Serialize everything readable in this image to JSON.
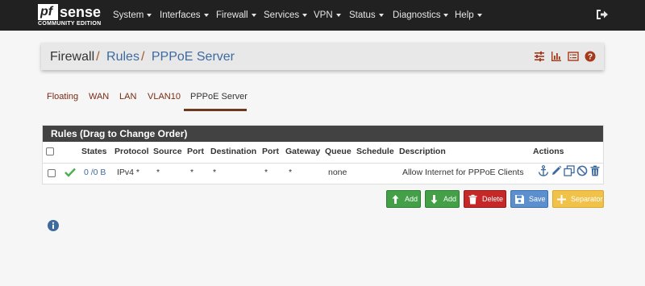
{
  "brand": {
    "logo_pf": "pf",
    "logo_sense": "sense",
    "edition": "COMMUNITY EDITION"
  },
  "nav": {
    "items": [
      {
        "label": "System"
      },
      {
        "label": "Interfaces"
      },
      {
        "label": "Firewall"
      },
      {
        "label": "Services"
      },
      {
        "label": "VPN"
      },
      {
        "label": "Status"
      },
      {
        "label": "Diagnostics"
      },
      {
        "label": "Help"
      }
    ],
    "logout_icon": "sign-out-icon"
  },
  "breadcrumb": {
    "firewall": "Firewall",
    "rules": "Rules",
    "current": "PPPoE Server",
    "separator": "/"
  },
  "header_icons": [
    "sliders-icon",
    "bar-chart-icon",
    "list-icon",
    "help-icon"
  ],
  "tabs": [
    {
      "label": "Floating",
      "active": false
    },
    {
      "label": "WAN",
      "active": false
    },
    {
      "label": "LAN",
      "active": false
    },
    {
      "label": "VLAN10",
      "active": false
    },
    {
      "label": "PPPoE Server",
      "active": true
    }
  ],
  "rules": {
    "title": "Rules (Drag to Change Order)",
    "columns": {
      "states": "States",
      "protocol": "Protocol",
      "source": "Source",
      "port": "Port",
      "destination": "Destination",
      "dest_port": "Port",
      "gateway": "Gateway",
      "queue": "Queue",
      "schedule": "Schedule",
      "description": "Description",
      "actions": "Actions"
    },
    "rows": [
      {
        "enabled_icon": "check-icon",
        "states": "0 /0 B",
        "protocol": "IPv4 *",
        "source": "*",
        "port": "*",
        "destination": "*",
        "dest_port": "*",
        "gateway": "*",
        "queue": "none",
        "schedule": "",
        "description": "Allow Internet for PPPoE Clients",
        "actions": [
          "anchor-icon",
          "pencil-icon",
          "copy-icon",
          "disable-icon",
          "trash-icon"
        ]
      }
    ]
  },
  "buttons": {
    "add_top": "Add",
    "add_bottom": "Add",
    "delete": "Delete",
    "save": "Save",
    "separator": "Separator"
  },
  "colors": {
    "navbar": "#212121",
    "table_header": "#424242",
    "link": "#3d6a9f",
    "green": "#43a047",
    "red": "#c62828",
    "blue": "#5c8fcd",
    "amber": "#f0c24a",
    "check": "#4caf50"
  },
  "info_icon": "info-circle-icon"
}
